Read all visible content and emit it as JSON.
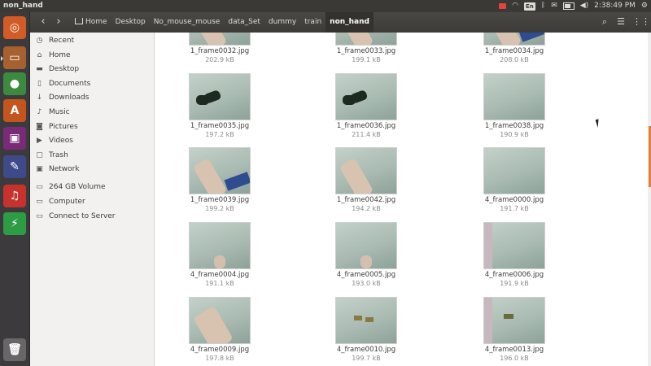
{
  "window": {
    "title": "non_hand"
  },
  "indicators": {
    "keyboard_layout": "En",
    "clock": "2:38:49 PM"
  },
  "launcher": {
    "items": [
      {
        "name": "ubuntu-dash-icon",
        "color": "#d35b25",
        "glyph": "◎"
      },
      {
        "name": "files-icon",
        "color": "#a7612f",
        "glyph": "▭"
      },
      {
        "name": "chrome-icon",
        "color": "#3b8a3e",
        "glyph": "●"
      },
      {
        "name": "software-center-icon",
        "color": "#c4551f",
        "glyph": "A"
      },
      {
        "name": "video-editor-icon",
        "color": "#7a2b78",
        "glyph": "▣"
      },
      {
        "name": "system-settings-icon",
        "color": "#3e4a8a",
        "glyph": "✎"
      },
      {
        "name": "sound-icon",
        "color": "#c7332c",
        "glyph": "♫"
      },
      {
        "name": "transfer-icon",
        "color": "#2e9b45",
        "glyph": "⚡"
      },
      {
        "name": "trash-icon",
        "color": "#676767",
        "glyph": "🗑"
      }
    ]
  },
  "toolbar": {
    "back_glyph": "‹",
    "forward_glyph": "›",
    "search_glyph": "⌕",
    "list_glyph": "☰",
    "grid_glyph": "⋮⋮"
  },
  "breadcrumbs": [
    "Home",
    "Desktop",
    "No_mouse_mouse",
    "data_Set",
    "dummy",
    "train",
    "non_hand"
  ],
  "sidebar": {
    "places": [
      {
        "label": "Recent",
        "icon": "clock-icon",
        "glyph": "◷"
      },
      {
        "label": "Home",
        "icon": "home-icon",
        "glyph": "⌂"
      },
      {
        "label": "Desktop",
        "icon": "folder-icon",
        "glyph": "▬"
      },
      {
        "label": "Documents",
        "icon": "document-icon",
        "glyph": "▯"
      },
      {
        "label": "Downloads",
        "icon": "download-icon",
        "glyph": "↓"
      },
      {
        "label": "Music",
        "icon": "music-icon",
        "glyph": "♪"
      },
      {
        "label": "Pictures",
        "icon": "camera-icon",
        "glyph": "◙"
      },
      {
        "label": "Videos",
        "icon": "video-icon",
        "glyph": "▶"
      },
      {
        "label": "Trash",
        "icon": "trash-icon",
        "glyph": "▢"
      },
      {
        "label": "Network",
        "icon": "network-icon",
        "glyph": "▣"
      }
    ],
    "devices": [
      {
        "label": "264 GB Volume",
        "icon": "drive-icon",
        "glyph": "▭"
      },
      {
        "label": "Computer",
        "icon": "computer-icon",
        "glyph": "▭"
      },
      {
        "label": "Connect to Server",
        "icon": "server-icon",
        "glyph": "▭"
      }
    ]
  },
  "files": [
    {
      "name": "1_frame0032.jpg",
      "size": "202.9 kB",
      "content": "arm"
    },
    {
      "name": "1_frame0033.jpg",
      "size": "199.1 kB",
      "content": "arm"
    },
    {
      "name": "1_frame0034.jpg",
      "size": "208.0 kB",
      "content": "arm-blue"
    },
    {
      "name": "1_frame0035.jpg",
      "size": "197.2 kB",
      "content": "mouse"
    },
    {
      "name": "1_frame0036.jpg",
      "size": "211.4 kB",
      "content": "mouse"
    },
    {
      "name": "1_frame0038.jpg",
      "size": "190.9 kB",
      "content": "empty"
    },
    {
      "name": "1_frame0039.jpg",
      "size": "199.2 kB",
      "content": "arm-blue"
    },
    {
      "name": "1_frame0042.jpg",
      "size": "194.2 kB",
      "content": "arm"
    },
    {
      "name": "4_frame0000.jpg",
      "size": "191.7 kB",
      "content": "empty"
    },
    {
      "name": "4_frame0004.jpg",
      "size": "191.1 kB",
      "content": "hand-small"
    },
    {
      "name": "4_frame0005.jpg",
      "size": "193.0 kB",
      "content": "hand-small"
    },
    {
      "name": "4_frame0006.jpg",
      "size": "191.9 kB",
      "content": "edge"
    },
    {
      "name": "4_frame0009.jpg",
      "size": "197.8 kB",
      "content": "arm-big"
    },
    {
      "name": "4_frame0010.jpg",
      "size": "199.7 kB",
      "content": "objects"
    },
    {
      "name": "4_frame0013.jpg",
      "size": "196.0 kB",
      "content": "edge-objects"
    }
  ]
}
